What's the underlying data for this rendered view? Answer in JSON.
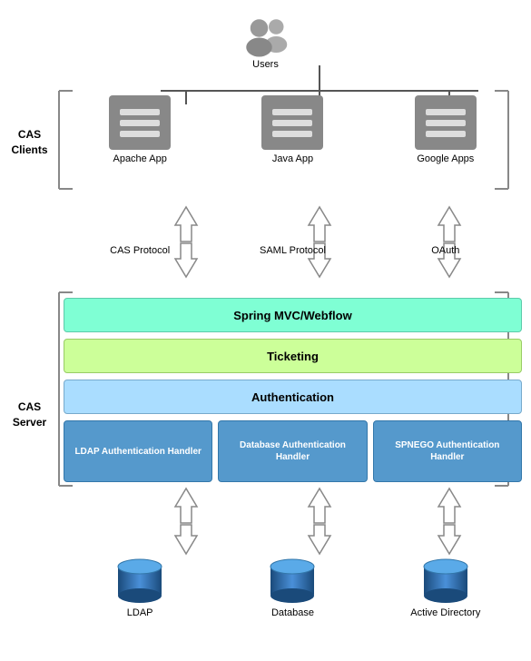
{
  "users": {
    "label": "Users"
  },
  "cas_clients": {
    "label": "CAS Clients",
    "apps": [
      {
        "name": "Apache App"
      },
      {
        "name": "Java App"
      },
      {
        "name": "Google Apps"
      }
    ]
  },
  "protocols": [
    {
      "label": "CAS Protocol"
    },
    {
      "label": "SAML Protocol"
    },
    {
      "label": "OAuth"
    }
  ],
  "cas_server": {
    "label": "CAS Server",
    "layers": {
      "spring": "Spring MVC/Webflow",
      "ticketing": "Ticketing",
      "authentication": "Authentication"
    },
    "handlers": [
      "LDAP Authentication Handler",
      "Database Authentication Handler",
      "SPNEGO Authentication Handler"
    ]
  },
  "databases": [
    {
      "name": "LDAP"
    },
    {
      "name": "Database"
    },
    {
      "name": "Active Directory"
    }
  ]
}
